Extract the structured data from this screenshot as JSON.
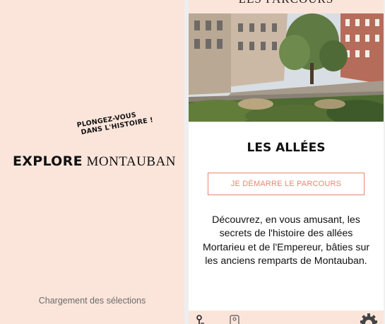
{
  "splash": {
    "tagline_line1": "PLONGEZ-VOUS",
    "tagline_line2": "DANS L'HISTOIRE !",
    "logo_bold": "EXPLORE",
    "logo_light": "MONTAUBAN",
    "loading_text": "Chargement des sélections"
  },
  "detail": {
    "header_title": "LES PARCOURS",
    "title": "LES ALLÉES",
    "start_button": "JE DÉMARRE LE PARCOURS",
    "description": "Découvrez, en vous amusant, les secrets de l'histoire des allées Mortarieu et de l'Empereur, bâties sur les anciens remparts de Montauban."
  },
  "tabbar": {
    "icons": [
      "map-pin-icon",
      "bookmark-icon",
      "settings-gear-icon"
    ]
  },
  "colors": {
    "peach_background": "#fbe5db",
    "accent": "#e8876e",
    "text": "#111111"
  }
}
